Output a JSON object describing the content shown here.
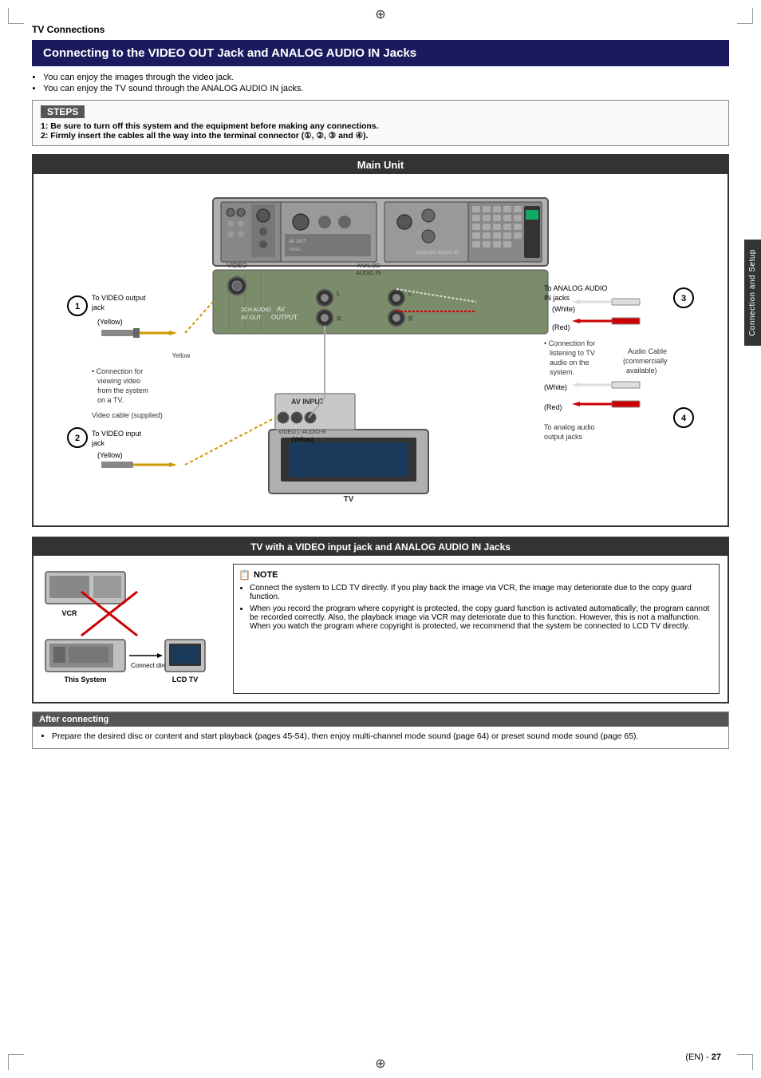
{
  "page": {
    "section_title": "TV Connections",
    "main_heading": "Connecting to the VIDEO OUT Jack and ANALOG AUDIO IN Jacks",
    "bullets": [
      "You can enjoy the images through the video jack.",
      "You can enjoy the TV sound through the ANALOG AUDIO IN jacks."
    ],
    "steps_title": "STEPS",
    "steps": [
      "1: Be sure to turn off this system and the equipment before making any connections.",
      "2: Firmly insert the cables all the way into the terminal connector (①, ②, ③ and ④)."
    ],
    "main_unit_title": "Main Unit",
    "connector1": {
      "label": "To VIDEO output jack",
      "color": "Yellow"
    },
    "connector2": {
      "label": "To VIDEO input jack",
      "color": "Yellow"
    },
    "connector3": {
      "label": "To ANALOG AUDIO IN jacks",
      "colors": [
        "White",
        "Red"
      ]
    },
    "connector4": {
      "label": "To analog audio output jacks",
      "colors": [
        "White",
        "Red"
      ]
    },
    "video_label": "VIDEO",
    "analog_audio_label": "ANALOG\nAUDIO IN",
    "av_out_label": "2CH AUDIO\nAV OUT",
    "av_output_label": "AV\nOUTPUT",
    "av_input_label": "AV INPUT",
    "video_cable_label": "Video cable (supplied)",
    "audio_cable_label": "Audio Cable\n(commercially\navailable)",
    "connection_note_video": "Connection for viewing video from the system on a TV.",
    "connection_note_audio": "Connection for listening to TV audio on the system.",
    "tv_section_title": "TV with a VIDEO input jack and ANALOG AUDIO IN Jacks",
    "vcr_label": "VCR",
    "this_system_label": "This System",
    "connect_directly_label": "Connect directly",
    "lcd_tv_label": "LCD TV",
    "note_title": "NOTE",
    "note_items": [
      "Connect the system to LCD TV directly. If you play back the image via VCR, the image may deteriorate due to the copy guard function.",
      "When you record the program where copyright is protected, the copy guard function is activated automatically; the program cannot be recorded correctly. Also, the playback image via VCR may deteriorate due to this function. However, this is not a malfunction. When you watch the program where copyright is protected, we recommend that the system be connected to LCD TV directly."
    ],
    "after_connecting_title": "After connecting",
    "after_connecting_items": [
      "Prepare the desired disc or content and start playback (pages 45-54), then enjoy multi-channel mode sound (page 64) or preset sound mode sound (page 65)."
    ],
    "page_number": "27",
    "side_tab": "Connection and Setup",
    "l_audio_r_label": "L-AUDIO-R",
    "yellow_label": "Yellow"
  }
}
